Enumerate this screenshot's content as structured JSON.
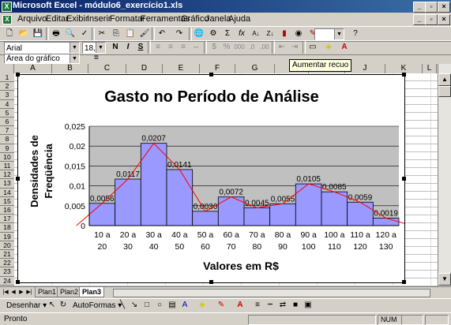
{
  "window": {
    "title": "Microsoft Excel - módulo6_exercício1.xls",
    "app_icon": "excel-icon"
  },
  "menu": [
    "Arquivo",
    "Editar",
    "Exibir",
    "Inserir",
    "Formatar",
    "Ferramentas",
    "Gráfico",
    "Janela",
    "Ajuda"
  ],
  "toolbar": {
    "zoom_value": "",
    "font_name": "Arial",
    "font_size": "18,5",
    "bold_label": "N",
    "italic_label": "I",
    "underline_label": "S",
    "icons": [
      "new-icon",
      "open-icon",
      "save-icon",
      "print-icon",
      "print-preview-icon",
      "spelling-icon",
      "cut-icon",
      "copy-icon",
      "paste-icon",
      "format-painter-icon",
      "undo-icon",
      "redo-icon",
      "hyperlink-icon",
      "web-icon",
      "autosum-icon",
      "function-icon",
      "sort-asc-icon",
      "sort-desc-icon",
      "chart-wizard-icon",
      "map-icon",
      "drawing-icon",
      "help-icon"
    ]
  },
  "formula_bar": {
    "name_box": "Área do gráfico",
    "equals": "="
  },
  "tooltip": "Aumentar recuo",
  "columns": [
    "A",
    "B",
    "C",
    "D",
    "E",
    "F",
    "G",
    "H",
    "I",
    "J",
    "K",
    "L"
  ],
  "rows": [
    "1",
    "2",
    "3",
    "4",
    "5",
    "6",
    "7",
    "8",
    "9",
    "10",
    "11",
    "12",
    "13",
    "14",
    "15",
    "16",
    "17",
    "18",
    "19",
    "20",
    "21",
    "22",
    "23",
    "24"
  ],
  "sheet_tabs": [
    "Plan1",
    "Plan2",
    "Plan3"
  ],
  "active_tab": "Plan3",
  "drawing_toolbar": {
    "draw_label": "Desenhar",
    "autoshapes_label": "AutoFormas"
  },
  "status": {
    "text": "Pronto",
    "num": "NUM"
  },
  "colors": {
    "bar_fill": "#9999ff",
    "plot_bg": "#c0c0c0",
    "trend_line": "#ff0000",
    "title_bar": "#0a246a"
  },
  "chart_data": {
    "type": "bar",
    "title": "Gasto no Período de Análise",
    "xlabel": "Valores em R$",
    "ylabel": "Densidades de Freqüência",
    "categories": [
      [
        "10 a",
        "20"
      ],
      [
        "20 a",
        "30"
      ],
      [
        "30 a",
        "40"
      ],
      [
        "40 a",
        "50"
      ],
      [
        "50 a",
        "60"
      ],
      [
        "60 a",
        "70"
      ],
      [
        "70 a",
        "80"
      ],
      [
        "80 a",
        "90"
      ],
      [
        "90 a",
        "100"
      ],
      [
        "100 a",
        "110"
      ],
      [
        "110 a",
        "120"
      ],
      [
        "120 a",
        "130"
      ]
    ],
    "values": [
      0.0056,
      0.0117,
      0.0207,
      0.0141,
      0.0036,
      0.0072,
      0.0045,
      0.0055,
      0.0105,
      0.0085,
      0.0059,
      0.0019
    ],
    "data_labels": [
      "0,0056",
      "0,0117",
      "0,0207",
      "0,0141",
      "0,0036",
      "0,0072",
      "0,0045",
      "0,0055",
      "0,0105",
      "0,0085",
      "0,0059",
      "0,0019"
    ],
    "yticks": [
      "0",
      "0,005",
      "0,01",
      "0,015",
      "0,02",
      "0,025"
    ],
    "ylim": [
      0,
      0.025
    ],
    "grid": true,
    "legend": "none",
    "overlay": "frequency-polygon"
  }
}
